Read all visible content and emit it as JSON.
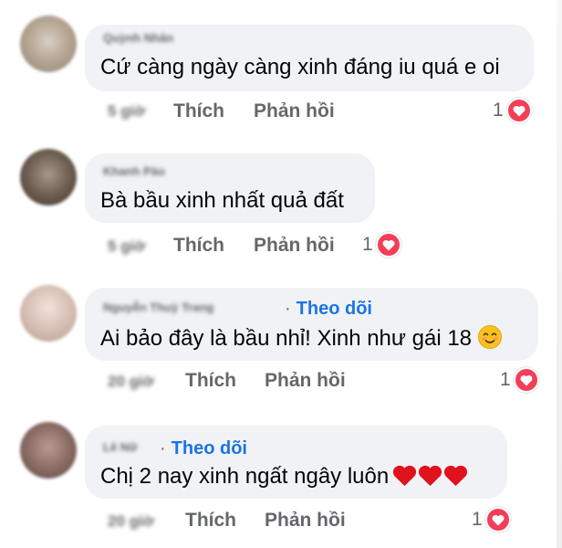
{
  "actions": {
    "like": "Thích",
    "reply": "Phản hồi"
  },
  "colors": {
    "bubble": "#f0f2f5",
    "follow": "#1b74e4",
    "heart": "#f33e58",
    "muted": "#65676b"
  },
  "comments": [
    {
      "author": "Quỳnh Nhân",
      "follow_label": "",
      "text": "Cứ càng ngày càng xinh đáng iu quá e oi",
      "time": "5 giờ",
      "reaction_count": "1",
      "reaction_icon": "heart-icon"
    },
    {
      "author": "Khanh Pào",
      "follow_label": "",
      "text": "Bà bầu xinh nhất quả đất",
      "time": "5 giờ",
      "reaction_count": "1",
      "reaction_icon": "heart-icon"
    },
    {
      "author": "Nguyễn Thuỳ Trang",
      "follow_label": "Theo dõi",
      "text": "Ai bảo đây là bầu nhỉ! Xinh như gái 18",
      "emoji": "smiling-face-icon",
      "time": "20 giờ",
      "reaction_count": "1",
      "reaction_icon": "heart-icon"
    },
    {
      "author": "Lê Nữ",
      "follow_label": "Theo dõi",
      "text": "Chị 2 nay xinh ngất ngây luôn",
      "emoji": "red-hearts-icon",
      "time": "20 giờ",
      "reaction_count": "1",
      "reaction_icon": "heart-icon"
    }
  ]
}
